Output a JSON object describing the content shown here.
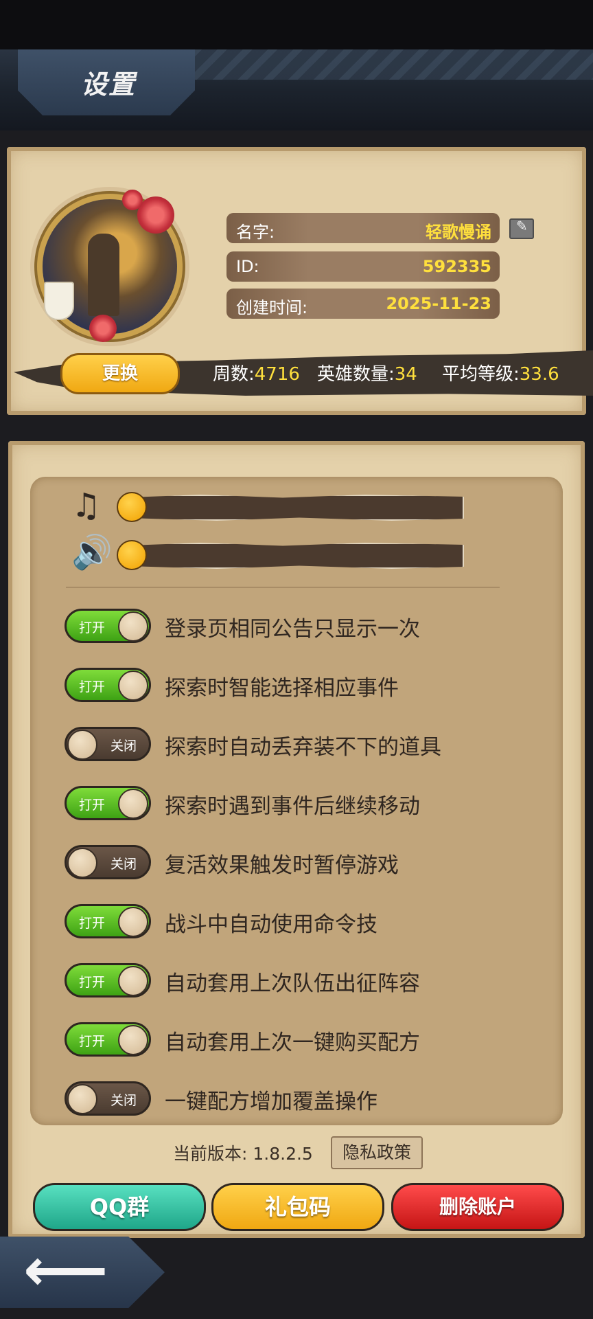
{
  "header": {
    "title": "设置"
  },
  "profile": {
    "name_label": "名字:",
    "name_value": "轻歌慢诵",
    "id_label": "ID:",
    "id_value": "592335",
    "created_label": "创建时间:",
    "created_value": "2025-11-23",
    "change_button": "更换",
    "stats": {
      "weeks_label": "周数:",
      "weeks_value": "4716",
      "heroes_label": "英雄数量:",
      "heroes_value": "34",
      "avg_level_label": "平均等级:",
      "avg_level_value": "33.6"
    }
  },
  "audio": {
    "music_icon": "music-note-icon",
    "sound_icon": "speaker-icon",
    "music_level": 0.0,
    "sound_level": 0.0
  },
  "settings": [
    {
      "state": "打开",
      "on": true,
      "text": "登录页相同公告只显示一次"
    },
    {
      "state": "打开",
      "on": true,
      "text": "探索时智能选择相应事件"
    },
    {
      "state": "关闭",
      "on": false,
      "text": "探索时自动丢弃装不下的道具"
    },
    {
      "state": "打开",
      "on": true,
      "text": "探索时遇到事件后继续移动"
    },
    {
      "state": "关闭",
      "on": false,
      "text": "复活效果触发时暂停游戏"
    },
    {
      "state": "打开",
      "on": true,
      "text": "战斗中自动使用命令技"
    },
    {
      "state": "打开",
      "on": true,
      "text": "自动套用上次队伍出征阵容"
    },
    {
      "state": "打开",
      "on": true,
      "text": "自动套用上次一键购买配方"
    },
    {
      "state": "关闭",
      "on": false,
      "text": "一键配方增加覆盖操作"
    }
  ],
  "footer": {
    "version": "当前版本: 1.8.2.5",
    "privacy": "隐私政策",
    "qq_group": "QQ群",
    "gift_code": "礼包码",
    "delete_account": "删除账户"
  },
  "colors": {
    "toggle_on": "#4fbf1f",
    "toggle_off": "#4a3b30",
    "value_yellow": "#ffe03d",
    "parchment": "#e4d1aa"
  }
}
